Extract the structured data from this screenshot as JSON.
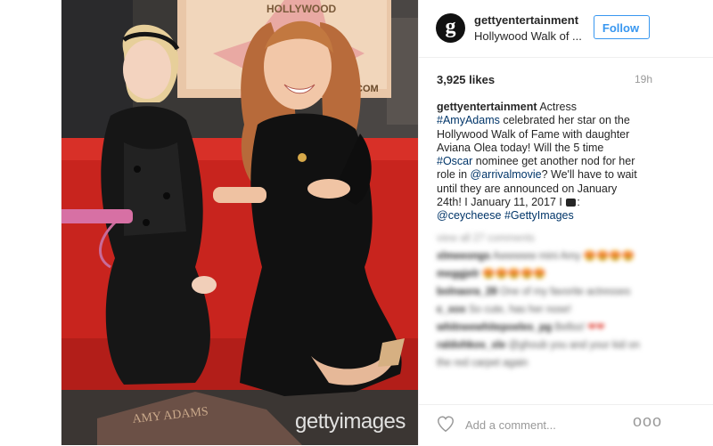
{
  "post": {
    "username": "gettyentertainment",
    "location": "Hollywood Walk of ...",
    "follow_label": "Follow",
    "avatar_letter": "g",
    "likes": "3,925 likes",
    "time": "19h",
    "caption": {
      "author": "gettyentertainment",
      "p1": " Actress ",
      "tag1": "#AmyAdams",
      "p2": " celebrated her star on the Hollywood Walk of Fame with daughter Aviana Olea today! Will the 5 time ",
      "tag2": "#Oscar",
      "p3": " nominee get another nod for her role in ",
      "tag3": "@arrivalmovie",
      "p4": "? We'll have to wait until they are announced on January 24th! I January 11, 2017 I ",
      "tag4": "@ceycheese",
      "tag5": "#GettyImages"
    },
    "photo": {
      "watermark": "gettyimages",
      "sign_text": "HOLLYWOOD",
      "sign_suffix": "COM",
      "star_name": "AMY ADAMS"
    },
    "comments": {
      "view_all": "view all 27 comments",
      "items": [
        {
          "user": "xlmeeongs",
          "text": "Awwwww mini Amy ",
          "emoji": "😍😍😍😍"
        },
        {
          "user": "meggjelr",
          "text": "",
          "emoji": "😍😍😍😍😍"
        },
        {
          "user": "bolnaora_28",
          "text": "One of my favorite actresses",
          "emoji": ""
        },
        {
          "user": "c_xox",
          "text": "So cute, has her nose!",
          "emoji": ""
        },
        {
          "user": "whitneewhitepoeles_pg",
          "text": "Bellss!",
          "emoji": "❤❤"
        },
        {
          "user": "raldohkos_xle",
          "text": "@ghoub you and your kid on the red carpet again",
          "emoji": ""
        }
      ]
    },
    "comment_placeholder": "Add a comment...",
    "more_label": "ooo"
  }
}
